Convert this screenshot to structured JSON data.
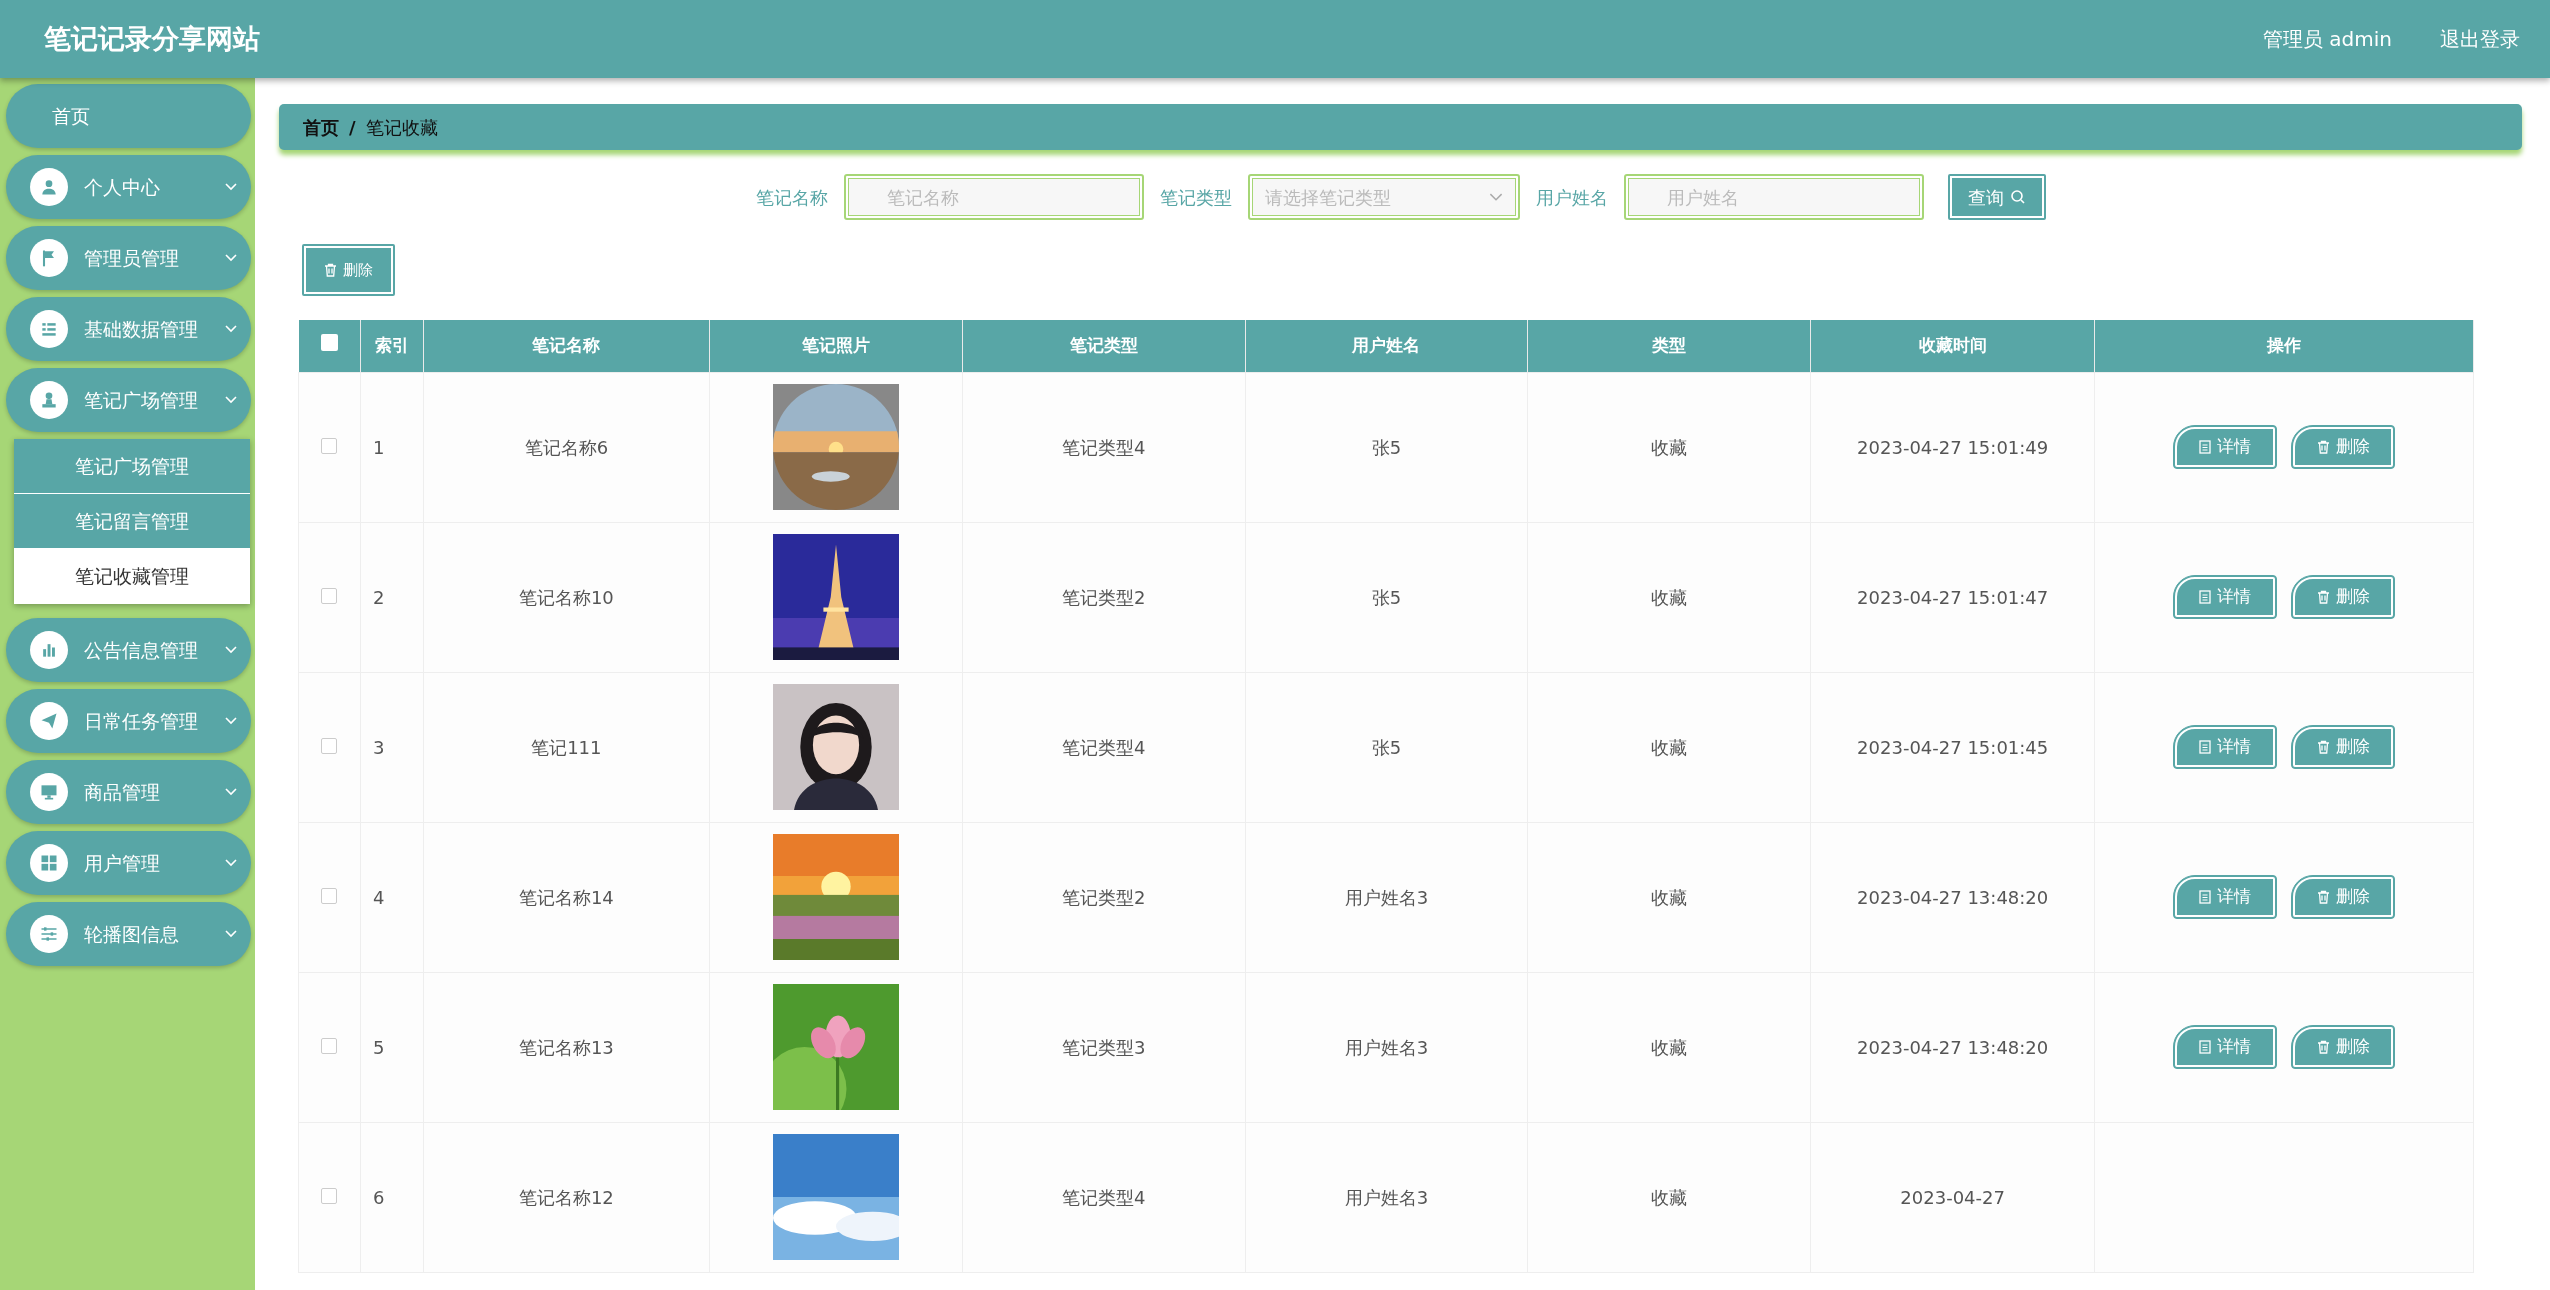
{
  "header": {
    "title": "笔记记录分享网站",
    "user": "管理员 admin",
    "logout": "退出登录"
  },
  "sidebar": {
    "items": [
      {
        "label": "首页",
        "kind": "link"
      },
      {
        "label": "个人中心",
        "kind": "menu"
      },
      {
        "label": "管理员管理",
        "kind": "menu"
      },
      {
        "label": "基础数据管理",
        "kind": "menu"
      },
      {
        "label": "笔记广场管理",
        "kind": "menu",
        "children": [
          {
            "label": "笔记广场管理",
            "selected": false
          },
          {
            "label": "笔记留言管理",
            "selected": false
          },
          {
            "label": "笔记收藏管理",
            "selected": true
          }
        ]
      },
      {
        "label": "公告信息管理",
        "kind": "menu"
      },
      {
        "label": "日常任务管理",
        "kind": "menu"
      },
      {
        "label": "商品管理",
        "kind": "menu"
      },
      {
        "label": "用户管理",
        "kind": "menu"
      },
      {
        "label": "轮播图信息",
        "kind": "menu"
      }
    ]
  },
  "breadcrumb": [
    "首页",
    "/",
    "笔记收藏"
  ],
  "search": {
    "fields": [
      {
        "label": "笔记名称",
        "placeholder": "笔记名称",
        "kind": "text"
      },
      {
        "label": "笔记类型",
        "placeholder": "请选择笔记类型",
        "kind": "select"
      },
      {
        "label": "用户姓名",
        "placeholder": "用户姓名",
        "kind": "text"
      }
    ],
    "button": "查询"
  },
  "delete_button": "删除",
  "table": {
    "select_all_checked": false,
    "columns": [
      "索引",
      "笔记名称",
      "笔记照片",
      "笔记类型",
      "用户姓名",
      "类型",
      "收藏时间",
      "操作"
    ],
    "rows": [
      {
        "checked": false,
        "index": "1",
        "name": "笔记名称6",
        "photo": {
          "kind": "picture"
        },
        "type": "笔记类型4",
        "user": "张5",
        "category": "收藏",
        "time": "2023-04-27 15:01:49",
        "actions": [
          "详情",
          "删除"
        ]
      },
      {
        "checked": false,
        "index": "2",
        "name": "笔记名称10",
        "photo": {
          "kind": "picture"
        },
        "type": "笔记类型2",
        "user": "张5",
        "category": "收藏",
        "time": "2023-04-27 15:01:47",
        "actions": [
          "详情",
          "删除"
        ]
      },
      {
        "checked": false,
        "index": "3",
        "name": "笔记111",
        "photo": {
          "kind": "picture"
        },
        "type": "笔记类型4",
        "user": "张5",
        "category": "收藏",
        "time": "2023-04-27 15:01:45",
        "actions": [
          "详情",
          "删除"
        ]
      },
      {
        "checked": false,
        "index": "4",
        "name": "笔记名称14",
        "photo": {
          "kind": "picture"
        },
        "type": "笔记类型2",
        "user": "用户姓名3",
        "category": "收藏",
        "time": "2023-04-27 13:48:20",
        "actions": [
          "详情",
          "删除"
        ]
      },
      {
        "checked": false,
        "index": "5",
        "name": "笔记名称13",
        "photo": {
          "kind": "picture"
        },
        "type": "笔记类型3",
        "user": "用户姓名3",
        "category": "收藏",
        "time": "2023-04-27 13:48:20",
        "actions": [
          "详情",
          "删除"
        ]
      },
      {
        "checked": false,
        "index": "6",
        "name": "笔记名称12",
        "photo": {
          "kind": "picture"
        },
        "type": "笔记类型4",
        "user": "用户姓名3",
        "category": "收藏",
        "time": "2023-04-27"
      }
    ]
  }
}
